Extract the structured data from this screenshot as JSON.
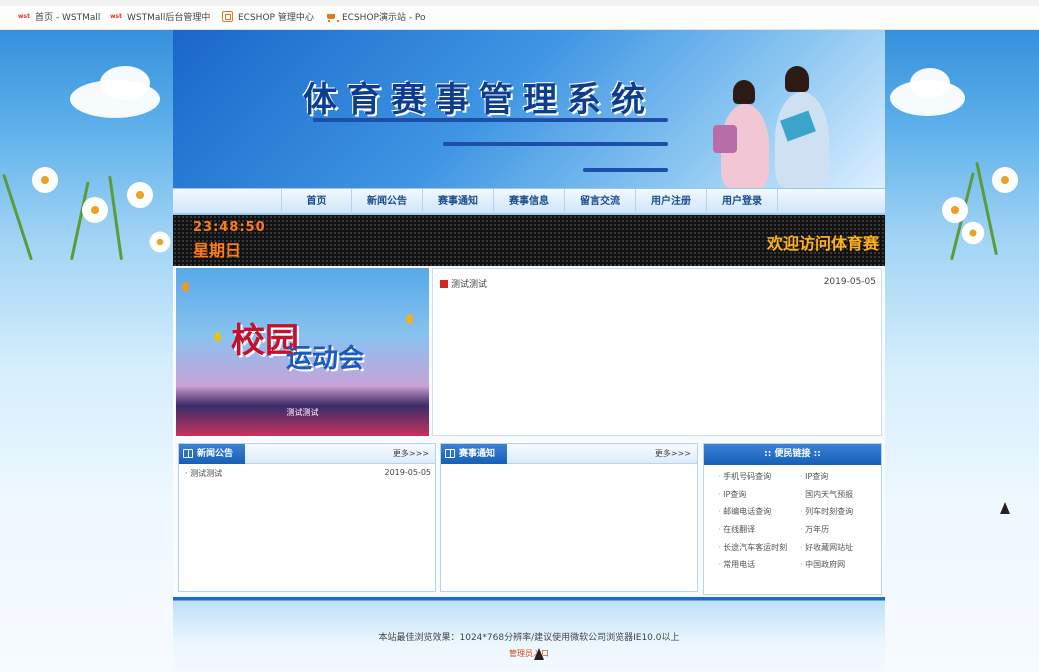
{
  "bookmarks": [
    {
      "icon": "wst-icon",
      "label": "首页 - WSTMall"
    },
    {
      "icon": "wst-icon",
      "label": "WSTMall后台管理中"
    },
    {
      "icon": "ecshop-icon",
      "label": "ECSHOP 管理中心"
    },
    {
      "icon": "cart-icon",
      "label": "ECSHOP演示站 - Po"
    }
  ],
  "header": {
    "site_title": "体育赛事管理系统"
  },
  "nav": {
    "items": [
      "首页",
      "新闻公告",
      "赛事通知",
      "赛事信息",
      "留言交流",
      "用户注册",
      "用户登录"
    ]
  },
  "led": {
    "time": "23:48:50",
    "weekday": "星期日",
    "marquee": "欢迎访问体育赛"
  },
  "poster": {
    "title_main": "校园",
    "title_sub": "运动会",
    "caption": "测试测试"
  },
  "featured": {
    "items": [
      {
        "title": "测试测试",
        "date": "2019-05-05"
      }
    ]
  },
  "news": {
    "title": "新闻公告",
    "more": "更多>>>",
    "items": [
      {
        "title": "测试测试",
        "date": "2019-05-05"
      }
    ]
  },
  "notices": {
    "title": "赛事通知",
    "more": "更多>>>",
    "items": []
  },
  "links": {
    "title": ":: 便民链接 ::",
    "items": [
      "手机号码查询",
      "IP查询",
      "IP查询",
      "国内天气预报",
      "邮编电话查询",
      "列车时刻查询",
      "在线翻译",
      "万年历",
      "长途汽车客运时刻",
      "好收藏网站址",
      "常用电话",
      "中国政府网"
    ]
  },
  "footer": {
    "text": "本站最佳浏览效果：1024*768分辨率/建议使用微软公司浏览器IE10.0以上",
    "admin_link": "管理员入口"
  },
  "colors": {
    "nav_text": "#1a4c8c",
    "led_text": "#ff7a1a",
    "panel_header": "#155fb8",
    "admin_link": "#d9481d"
  }
}
